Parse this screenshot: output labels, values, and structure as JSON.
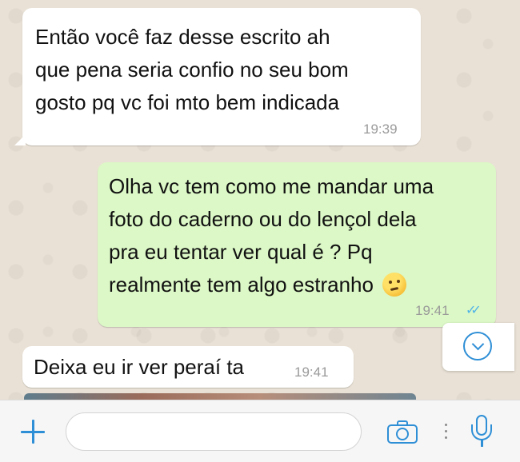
{
  "messages": [
    {
      "direction": "incoming",
      "lines": [
        "Então você faz desse escrito ah",
        "que pena seria confio no seu bom",
        "gosto pq vc foi mto bem indicada"
      ],
      "time": "19:39"
    },
    {
      "direction": "outgoing",
      "lines": [
        "Olha vc tem como me mandar uma",
        "foto do caderno ou do lençol dela",
        "pra eu tentar ver qual é ? Pq",
        "realmente tem algo estranho"
      ],
      "emoji": "thinking-face",
      "time": "19:41",
      "status": "read"
    },
    {
      "direction": "incoming",
      "lines": [
        "Deixa eu ir ver peraí ta"
      ],
      "time": "19:41"
    }
  ],
  "composer": {
    "placeholder": ""
  },
  "colors": {
    "incoming_bubble": "#ffffff",
    "outgoing_bubble": "#dcf8c6",
    "accent": "#2f8fd6",
    "read_ticks": "#4fb3e8",
    "timestamp": "#9a9a9a"
  },
  "icons": {
    "attach": "plus-icon",
    "camera": "camera-icon",
    "mic": "mic-icon",
    "scroll": "chevron-down-icon"
  }
}
